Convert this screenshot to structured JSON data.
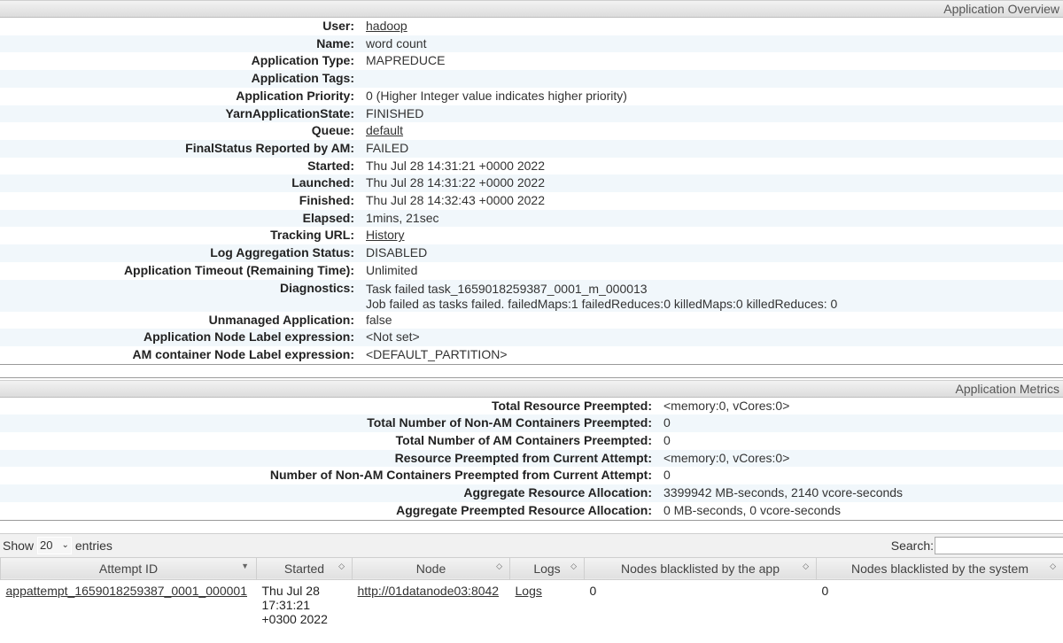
{
  "overview": {
    "section_title": "Application Overview",
    "rows": [
      {
        "label": "User:",
        "value": "hadoop",
        "link": true
      },
      {
        "label": "Name:",
        "value": "word count"
      },
      {
        "label": "Application Type:",
        "value": "MAPREDUCE"
      },
      {
        "label": "Application Tags:",
        "value": ""
      },
      {
        "label": "Application Priority:",
        "value": "0 (Higher Integer value indicates higher priority)"
      },
      {
        "label": "YarnApplicationState:",
        "value": "FINISHED"
      },
      {
        "label": "Queue:",
        "value": "default",
        "link": true
      },
      {
        "label": "FinalStatus Reported by AM:",
        "value": "FAILED"
      },
      {
        "label": "Started:",
        "value": "Thu Jul 28 14:31:21 +0000 2022"
      },
      {
        "label": "Launched:",
        "value": "Thu Jul 28 14:31:22 +0000 2022"
      },
      {
        "label": "Finished:",
        "value": "Thu Jul 28 14:32:43 +0000 2022"
      },
      {
        "label": "Elapsed:",
        "value": "1mins, 21sec"
      },
      {
        "label": "Tracking URL:",
        "value": "History",
        "link": true
      },
      {
        "label": "Log Aggregation Status:",
        "value": "DISABLED"
      },
      {
        "label": "Application Timeout (Remaining Time):",
        "value": "Unlimited"
      },
      {
        "label": "Diagnostics:",
        "value": "Task failed task_1659018259387_0001_m_000013",
        "value2": "Job failed as tasks failed. failedMaps:1 failedReduces:0 killedMaps:0 killedReduces: 0"
      },
      {
        "label": "Unmanaged Application:",
        "value": "false"
      },
      {
        "label": "Application Node Label expression:",
        "value": "<Not set>"
      },
      {
        "label": "AM container Node Label expression:",
        "value": "<DEFAULT_PARTITION>"
      }
    ]
  },
  "metrics": {
    "section_title": "Application Metrics",
    "rows": [
      {
        "label": "Total Resource Preempted:",
        "value": "<memory:0, vCores:0>"
      },
      {
        "label": "Total Number of Non-AM Containers Preempted:",
        "value": "0"
      },
      {
        "label": "Total Number of AM Containers Preempted:",
        "value": "0"
      },
      {
        "label": "Resource Preempted from Current Attempt:",
        "value": "<memory:0, vCores:0>"
      },
      {
        "label": "Number of Non-AM Containers Preempted from Current Attempt:",
        "value": "0"
      },
      {
        "label": "Aggregate Resource Allocation:",
        "value": "3399942 MB-seconds, 2140 vcore-seconds"
      },
      {
        "label": "Aggregate Preempted Resource Allocation:",
        "value": "0 MB-seconds, 0 vcore-seconds"
      }
    ]
  },
  "attempts": {
    "show_label": "Show",
    "page_size": "20",
    "entries_label": "entries",
    "search_label": "Search:",
    "columns": [
      "Attempt ID",
      "Started",
      "Node",
      "Logs",
      "Nodes blacklisted by the app",
      "Nodes blacklisted by the system"
    ],
    "rows": [
      {
        "attempt_id": "appattempt_1659018259387_0001_000001",
        "started_1": "Thu Jul 28",
        "started_2": "17:31:21",
        "started_3": "+0300 2022",
        "node": "http://01datanode03:8042",
        "logs": "Logs",
        "bl_app": "0",
        "bl_sys": "0"
      }
    ]
  }
}
